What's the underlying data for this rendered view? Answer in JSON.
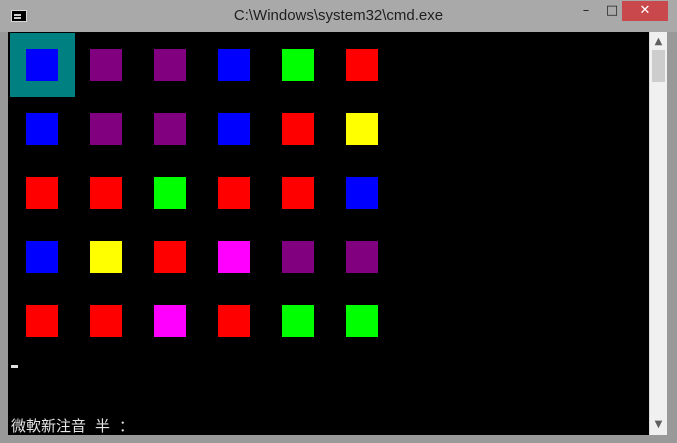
{
  "window": {
    "title": "C:\\Windows\\system32\\cmd.exe",
    "icon": "cmd-icon",
    "controls": {
      "minimize": "–",
      "maximize": "□",
      "close": "✕"
    }
  },
  "console": {
    "background": "#000000",
    "selection_color": "#008080",
    "ime_status": "微軟新注音 半 ："
  },
  "colors": {
    "blue": "#0000ff",
    "purple": "#800080",
    "green": "#00ff00",
    "red": "#ff0000",
    "yellow": "#ffff00",
    "magenta": "#ff00ff"
  },
  "grid": [
    [
      "blue",
      "purple",
      "purple",
      "blue",
      "green",
      "red"
    ],
    [
      "blue",
      "purple",
      "purple",
      "blue",
      "red",
      "yellow"
    ],
    [
      "red",
      "red",
      "green",
      "red",
      "red",
      "blue"
    ],
    [
      "blue",
      "yellow",
      "red",
      "magenta",
      "purple",
      "purple"
    ],
    [
      "red",
      "red",
      "magenta",
      "red",
      "green",
      "green"
    ]
  ],
  "scrollbar": {
    "up_icon": "▲",
    "down_icon": "▼"
  }
}
